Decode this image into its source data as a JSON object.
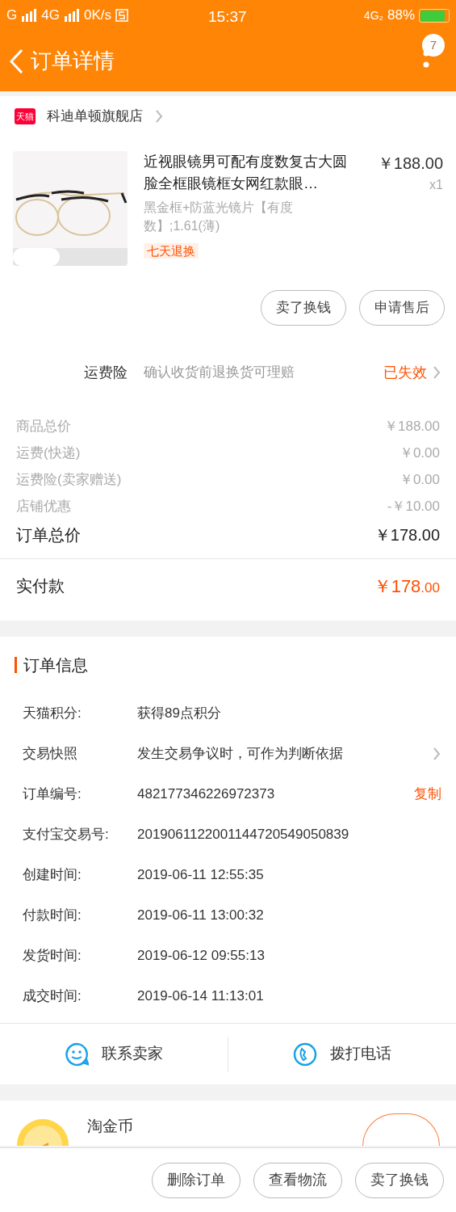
{
  "status_bar": {
    "left": [
      "G",
      "4G",
      "0K/s"
    ],
    "time": "15:37",
    "network": "4G₂",
    "battery": "88%"
  },
  "header": {
    "title": "订单详情",
    "badge": "7"
  },
  "store": {
    "badge": "天猫",
    "name": "科迪单顿旗舰店"
  },
  "product": {
    "title": "近视眼镜男可配有度数复古大圆脸全框眼镜框女网红款眼…",
    "price": "￥188.00",
    "quantity": "x1",
    "spec": "黑金框+防蓝光镜片【有度数】;1.61(薄)",
    "tag": "七天退换"
  },
  "item_buttons": [
    "卖了换钱",
    "申请售后"
  ],
  "insurance": {
    "label": "运费险",
    "description": "确认收货前退换货可理赔",
    "status": "已失效"
  },
  "price_rows": [
    {
      "label": "商品总价",
      "value": "￥188.00",
      "kind": "normal"
    },
    {
      "label": "运费(快递)",
      "value": "￥0.00",
      "kind": "normal"
    },
    {
      "label": "运费险(卖家赠送)",
      "value": "￥0.00",
      "kind": "normal"
    },
    {
      "label": "店铺优惠",
      "value": "-￥10.00",
      "kind": "normal"
    },
    {
      "label": "订单总价",
      "value": "￥178.00",
      "kind": "total"
    }
  ],
  "paid": {
    "label": "实付款",
    "integer": "￥178",
    "decimal": ".00"
  },
  "order_info": {
    "title": "订单信息",
    "rows": [
      {
        "label": "天猫积分:",
        "value": "获得89点积分"
      },
      {
        "label": "交易快照",
        "value": "发生交易争议时，可作为判断依据",
        "chevron": true
      },
      {
        "label": "订单编号:",
        "value": "482177346226972373",
        "action": "复制"
      },
      {
        "label": "支付宝交易号:",
        "value": "2019061122001144720549050839"
      },
      {
        "label": "创建时间:",
        "value": "2019-06-11 12:55:35"
      },
      {
        "label": "付款时间:",
        "value": "2019-06-11 13:00:32"
      },
      {
        "label": "发货时间:",
        "value": "2019-06-12 09:55:13"
      },
      {
        "label": "成交时间:",
        "value": "2019-06-14 11:13:01"
      }
    ]
  },
  "contact": [
    {
      "label": "联系卖家",
      "kind": "chat"
    },
    {
      "label": "拨打电话",
      "kind": "phone"
    }
  ],
  "coin": {
    "name": "淘金币"
  },
  "bottom_buttons": [
    "删除订单",
    "查看物流",
    "卖了换钱"
  ]
}
